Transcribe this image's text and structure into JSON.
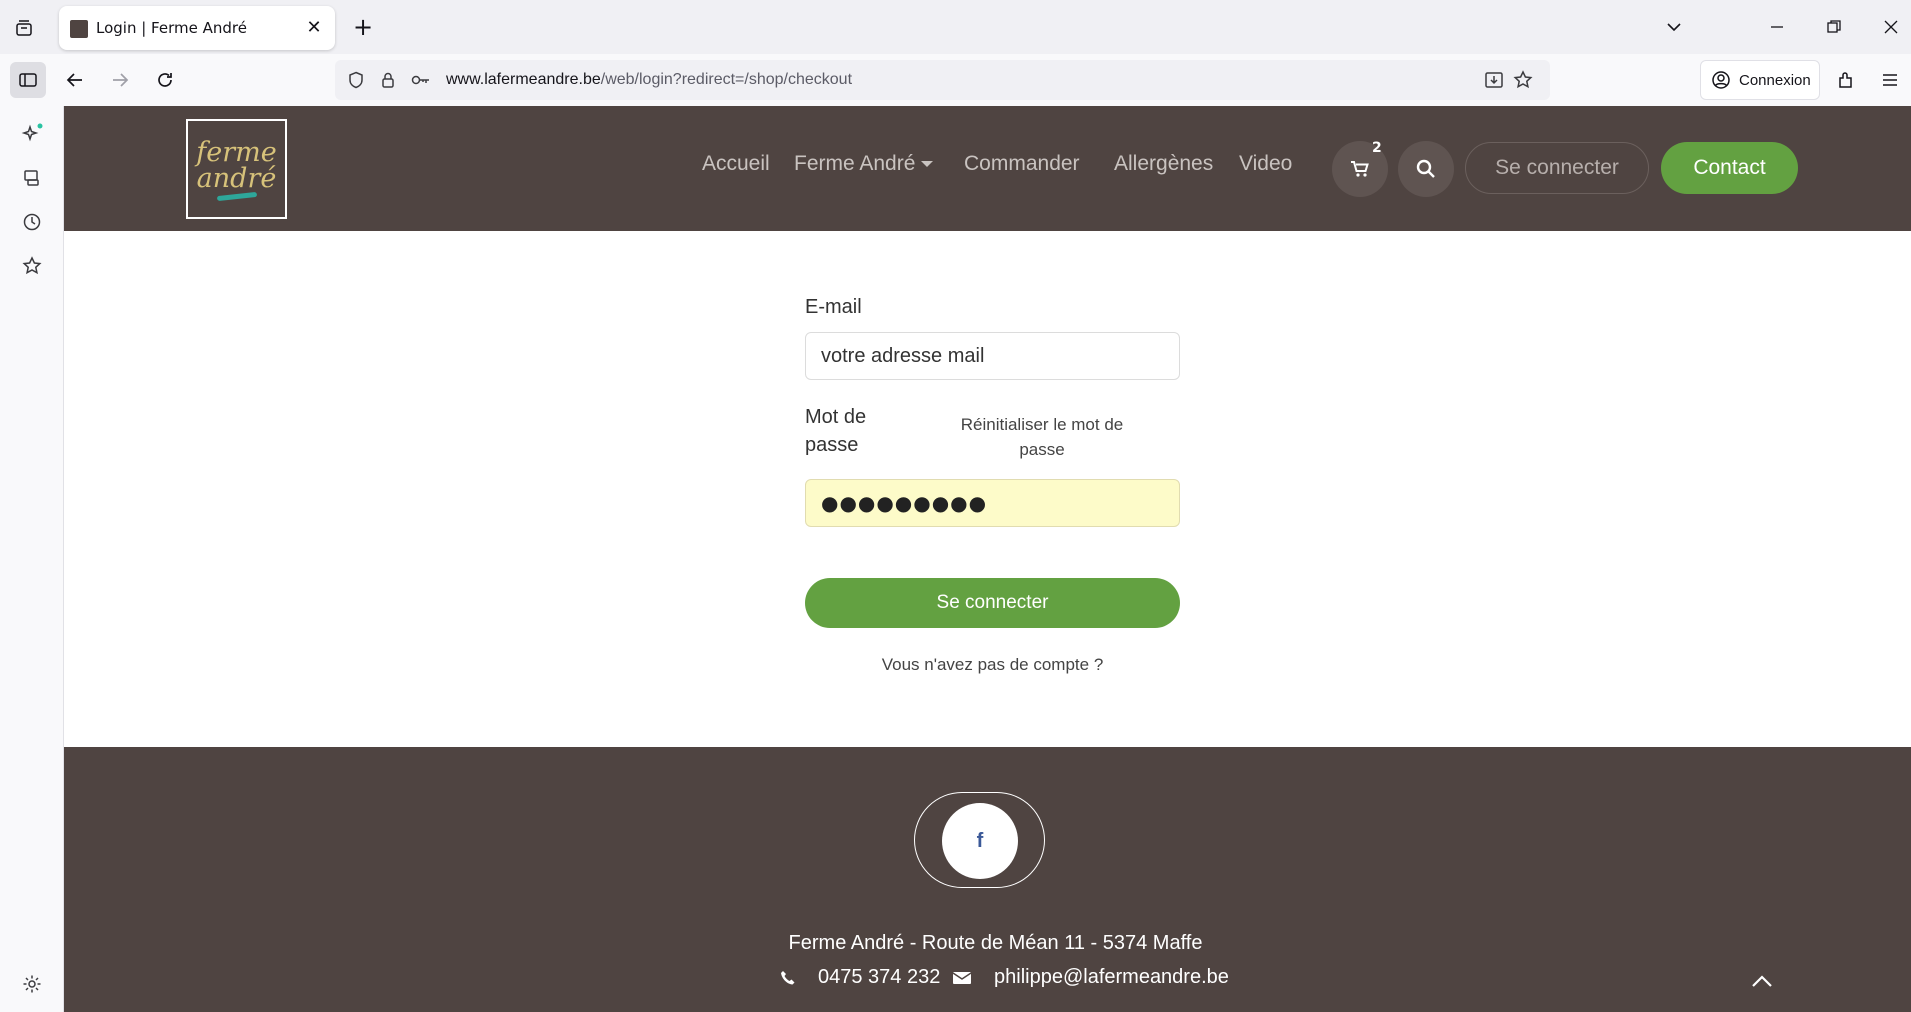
{
  "browser": {
    "tab_title": "Login | Ferme André",
    "tab_close": "✕",
    "new_tab": "+",
    "url_host": "www.lafermeandre.be",
    "url_path": "/web/login?redirect=/shop/checkout",
    "account_label": "Connexion"
  },
  "header": {
    "logo_line1": "ferme",
    "logo_line2": "andré",
    "menu": [
      "Accueil",
      "Ferme André",
      "Commander",
      "Allergènes",
      "Video"
    ],
    "cart_count": "2",
    "signin_label": "Se connecter",
    "contact_label": "Contact"
  },
  "form": {
    "email_label": "E-mail",
    "email_value": "votre adresse mail",
    "password_label_line1": "Mot de",
    "password_label_line2": "passe",
    "reset_link": "Réinitialiser le mot de passe",
    "password_value": "●●●●●●●●●",
    "submit_label": "Se connecter",
    "no_account_link": "Vous n'avez pas de compte ?"
  },
  "footer": {
    "facebook_letter": "f",
    "address": "Ferme André - Route de Méan 11 - 5374 Maffe",
    "phone": "0475 374 232",
    "email": "philippe@lafermeandre.be"
  },
  "colors": {
    "brand_brown": "#4f4441",
    "brand_green": "#63a141",
    "autofill_yellow": "#fdfbc9"
  }
}
